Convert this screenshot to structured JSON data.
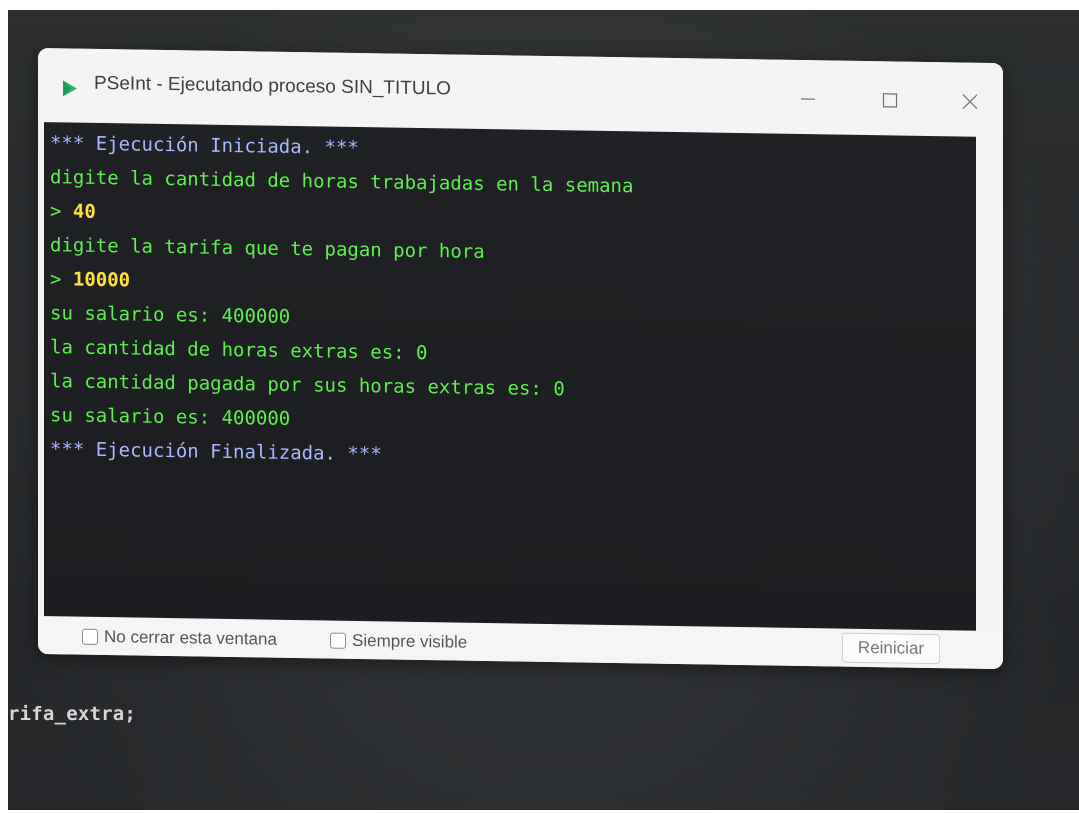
{
  "window": {
    "title": "PSeInt - Ejecutando proceso SIN_TITULO"
  },
  "console": {
    "lines": [
      {
        "text": "*** Ejecución Iniciada. ***",
        "kind": "system"
      },
      {
        "text": "digite la cantidad de horas trabajadas en la semana",
        "kind": "output"
      },
      {
        "prompt": ">",
        "text": "40",
        "kind": "input"
      },
      {
        "text": "digite la tarifa que te pagan por hora",
        "kind": "output"
      },
      {
        "prompt": ">",
        "text": "10000",
        "kind": "input"
      },
      {
        "text": "su salario es: 400000",
        "kind": "output"
      },
      {
        "text": "la cantidad de horas extras es: 0",
        "kind": "output"
      },
      {
        "text": "la cantidad pagada por sus horas extras es: 0",
        "kind": "output"
      },
      {
        "text": "su salario es: 400000",
        "kind": "output"
      },
      {
        "text": "*** Ejecución Finalizada. ***",
        "kind": "system"
      }
    ]
  },
  "footer": {
    "keep_open_label": "No cerrar esta ventana",
    "always_visible_label": "Siempre visible",
    "restart_label": "Reiniciar"
  },
  "background_code": {
    "text": "rifa_extra;"
  },
  "colors": {
    "system_text": "#a9b7ff",
    "output_text": "#5df04f",
    "input_text": "#ffe03a",
    "console_bg": "#1e1f22",
    "app_icon": "#2bb673"
  },
  "icons": {
    "app": "pseint-logo-icon",
    "minimize": "minimize-icon",
    "maximize": "maximize-icon",
    "close": "close-icon"
  }
}
